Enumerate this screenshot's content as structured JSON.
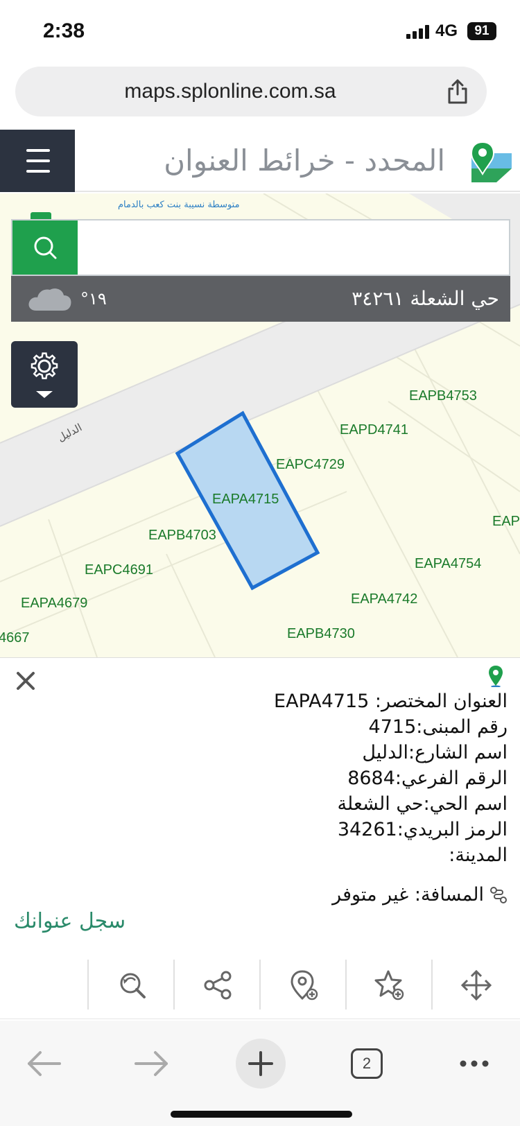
{
  "status": {
    "time": "2:38",
    "network": "4G",
    "battery": "91"
  },
  "browser": {
    "url": "maps.splonline.com.sa",
    "tabs_count": "2"
  },
  "app": {
    "title": "المحدد - خرائط العنوان الوطني"
  },
  "search": {
    "placeholder": "",
    "hint": "متوسطة نسيبة بنت كعب بالدمام",
    "district": "حي الشعلة ٣٤٢٦١",
    "temperature": "°١٩"
  },
  "map": {
    "street_label": "الدليل",
    "parcels": [
      {
        "id": "p1",
        "label": "EAPB4753"
      },
      {
        "id": "p2",
        "label": "EAPD4741"
      },
      {
        "id": "p3",
        "label": "EAPC4729"
      },
      {
        "id": "p4",
        "label": "EAPA4715"
      },
      {
        "id": "p5",
        "label": "EAPB4703"
      },
      {
        "id": "p6",
        "label": "EAPC4691"
      },
      {
        "id": "p7",
        "label": "EAPA4679"
      },
      {
        "id": "p8",
        "label": "4667"
      },
      {
        "id": "p9",
        "label": "EAPA4754"
      },
      {
        "id": "p10",
        "label": "EAPA4742"
      },
      {
        "id": "p11",
        "label": "EAPB4730"
      },
      {
        "id": "p12",
        "label": "EAP"
      }
    ]
  },
  "details": {
    "lines": [
      "العنوان المختصر: EAPA4715",
      "رقم المبنى:4715",
      "اسم الشارع:الدليل",
      "الرقم الفرعي:8684",
      "اسم الحي:حي الشعلة",
      "الرمز البريدي:34261",
      "المدينة:"
    ],
    "distance": "المسافة: غير متوفر",
    "register": "سجل عنوانك"
  },
  "toolbar": {
    "items": [
      {
        "icon": "zoom-out-search-icon"
      },
      {
        "icon": "share-icon"
      },
      {
        "icon": "add-location-icon"
      },
      {
        "icon": "add-favorite-icon"
      },
      {
        "icon": "move-icon"
      }
    ]
  },
  "colors": {
    "accent_green": "#1fa04d",
    "header_dark": "#2c3340",
    "parcel_blue": "#1e6fd0",
    "label_green": "#1a7a2a"
  }
}
